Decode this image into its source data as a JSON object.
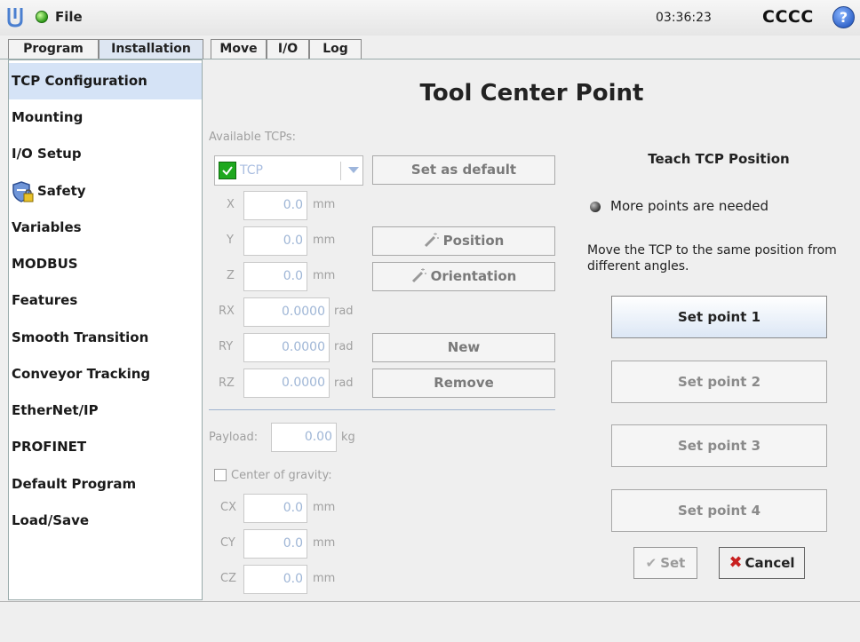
{
  "topbar": {
    "file_label": "File",
    "clock": "03:36:23",
    "robot_name": "CCCC",
    "help_label": "?"
  },
  "tabs": [
    {
      "label": "Program"
    },
    {
      "label": "Installation",
      "active": true
    },
    {
      "label": "Move"
    },
    {
      "label": "I/O"
    },
    {
      "label": "Log"
    }
  ],
  "sidebar": {
    "items": [
      {
        "label": "TCP Configuration",
        "active": true
      },
      {
        "label": "Mounting"
      },
      {
        "label": "I/O Setup"
      },
      {
        "label": "Safety",
        "icon": "safety-shield-lock-icon"
      },
      {
        "label": "Variables"
      },
      {
        "label": "MODBUS"
      },
      {
        "label": "Features"
      },
      {
        "label": "Smooth Transition"
      },
      {
        "label": "Conveyor Tracking"
      },
      {
        "label": "EtherNet/IP"
      },
      {
        "label": "PROFINET"
      },
      {
        "label": "Default Program"
      },
      {
        "label": "Load/Save"
      }
    ]
  },
  "main": {
    "title": "Tool Center Point",
    "available_tcps_label": "Available TCPs:",
    "tcp_selected": "TCP",
    "set_default_label": "Set as default",
    "coords": {
      "x": {
        "label": "X",
        "value": "0.0",
        "unit": "mm"
      },
      "y": {
        "label": "Y",
        "value": "0.0",
        "unit": "mm"
      },
      "z": {
        "label": "Z",
        "value": "0.0",
        "unit": "mm"
      },
      "rx": {
        "label": "RX",
        "value": "0.0000",
        "unit": "rad"
      },
      "ry": {
        "label": "RY",
        "value": "0.0000",
        "unit": "rad"
      },
      "rz": {
        "label": "RZ",
        "value": "0.0000",
        "unit": "rad"
      }
    },
    "position_label": "Position",
    "orientation_label": "Orientation",
    "new_label": "New",
    "remove_label": "Remove",
    "payload": {
      "label": "Payload:",
      "value": "0.00",
      "unit": "kg"
    },
    "cog_label": "Center of gravity:",
    "cog": {
      "cx": {
        "label": "CX",
        "value": "0.0",
        "unit": "mm"
      },
      "cy": {
        "label": "CY",
        "value": "0.0",
        "unit": "mm"
      },
      "cz": {
        "label": "CZ",
        "value": "0.0",
        "unit": "mm"
      }
    }
  },
  "teach": {
    "title": "Teach TCP Position",
    "status": "More points are needed",
    "instructions": "Move the TCP to the same position from different angles.",
    "points": [
      "Set point 1",
      "Set point 2",
      "Set point 3",
      "Set point 4"
    ],
    "set_label": "Set",
    "cancel_label": "Cancel"
  },
  "colors": {
    "accent": "#d5e3f6",
    "status_ok": "#2f9a1a",
    "cancel_x": "#c82020"
  }
}
